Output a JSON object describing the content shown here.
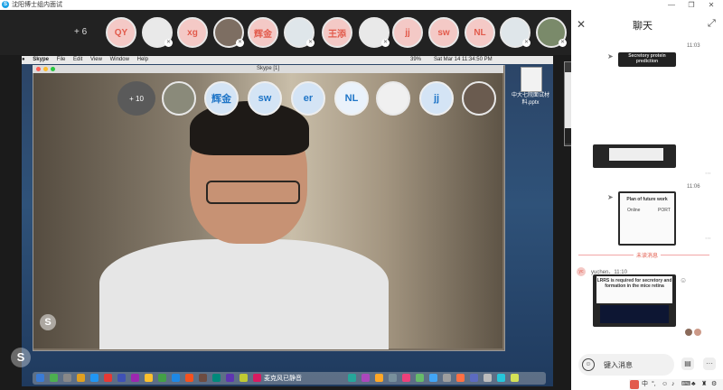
{
  "window": {
    "title": "沈阳博士组内面试",
    "minimize": "—",
    "restore": "❐",
    "close": "✕"
  },
  "top_participants": {
    "more_label": "+ 6",
    "items": [
      {
        "kind": "text",
        "label": "QY"
      },
      {
        "kind": "photo",
        "label": ""
      },
      {
        "kind": "text",
        "label": "xg"
      },
      {
        "kind": "photo",
        "label": ""
      },
      {
        "kind": "text",
        "label": "辉金"
      },
      {
        "kind": "photo",
        "label": ""
      },
      {
        "kind": "text",
        "label": "王添"
      },
      {
        "kind": "photo",
        "label": ""
      },
      {
        "kind": "text",
        "label": "jj"
      },
      {
        "kind": "text",
        "label": "sw"
      },
      {
        "kind": "text",
        "label": "NL"
      },
      {
        "kind": "photo",
        "label": ""
      },
      {
        "kind": "photo",
        "label": ""
      }
    ]
  },
  "mac_menu": {
    "items": [
      "",
      "Skype",
      "File",
      "Edit",
      "View",
      "Window",
      "Help"
    ],
    "battery": "39%",
    "clock": "Sat Mar 14  11:34:50 PM"
  },
  "skype_window": {
    "title": "Skype [1]",
    "more_label": "+ 10",
    "bubbles": [
      "辉金",
      "sw",
      "er",
      "NL",
      "jj"
    ]
  },
  "desktop_file": {
    "label": "中大七院面试材料.pptx"
  },
  "dock": {
    "caption": "麦克风已静音"
  },
  "chat": {
    "title": "聊天",
    "close": "✕",
    "expand": "⤢",
    "timestamps": [
      "11:03",
      "11:06"
    ],
    "slide_titles": [
      "Secretory protein prediction",
      "Plan of future work",
      "LRRS is required for secretory and formation in the mice retina"
    ],
    "slide2_cols": [
      "Online",
      "PORT"
    ],
    "unread_label": "未读消息",
    "sender": "yuchen、11:10",
    "sender_initial": "yc",
    "input_placeholder": "键入消息",
    "more": "···"
  },
  "tray": {
    "items": [
      "中",
      "°,",
      "☺",
      "♪",
      "⌨",
      "♣",
      "♜",
      "⚙"
    ]
  },
  "colors": {
    "accent_red": "#e25b4c",
    "hangup": "#e53935",
    "skype_blue": "#1aa1e6"
  }
}
